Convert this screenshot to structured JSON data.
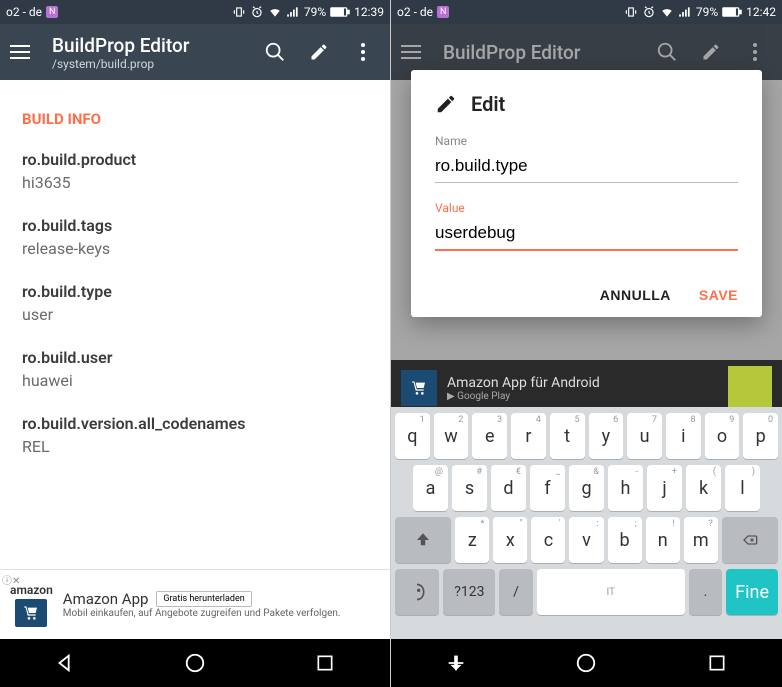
{
  "left": {
    "status": {
      "carrier": "o2 - de",
      "battery": "79%",
      "time": "12:39"
    },
    "toolbar": {
      "title": "BuildProp Editor",
      "subtitle": "/system/build.prop"
    },
    "section_header": "BUILD INFO",
    "props": [
      {
        "key": "ro.build.product",
        "val": "hi3635"
      },
      {
        "key": "ro.build.tags",
        "val": "release-keys"
      },
      {
        "key": "ro.build.type",
        "val": "user"
      },
      {
        "key": "ro.build.user",
        "val": "huawei"
      },
      {
        "key": "ro.build.version.all_codenames",
        "val": "REL"
      }
    ],
    "ad": {
      "brand": "amazon",
      "title": "Amazon App",
      "sub": "Mobil einkaufen, auf Angebote zugreifen und Pakete verfolgen.",
      "cta": "Gratis herunterladen"
    }
  },
  "right": {
    "status": {
      "carrier": "o2 - de",
      "battery": "79%",
      "time": "12:42"
    },
    "toolbar": {
      "title": "BuildProp Editor",
      "subtitle": "/system/build.prop"
    },
    "dialog": {
      "title": "Edit",
      "name_label": "Name",
      "name_value": "ro.build.type",
      "value_label": "Value",
      "value_value": "userdebug",
      "cancel": "ANNULLA",
      "save": "SAVE"
    },
    "adstrip": {
      "title": "Amazon App für Android",
      "sub": "Google Play"
    },
    "keyboard": {
      "row1": [
        "q",
        "w",
        "e",
        "r",
        "t",
        "y",
        "u",
        "i",
        "o",
        "p"
      ],
      "row1_hints": [
        "1",
        "2",
        "3",
        "4",
        "5",
        "6",
        "7",
        "8",
        "9",
        "0"
      ],
      "row2": [
        "a",
        "s",
        "d",
        "f",
        "g",
        "h",
        "j",
        "k",
        "l"
      ],
      "row2_hints": [
        "@",
        "#",
        "€",
        "_",
        "&",
        "-",
        "+",
        "(",
        ")"
      ],
      "row3": [
        "z",
        "x",
        "c",
        "v",
        "b",
        "n",
        "m"
      ],
      "row3_hints": [
        "*",
        "\"",
        "'",
        ":",
        ";",
        "!",
        "?"
      ],
      "symkey": "?123",
      "lang": "IT",
      "done": "Fine"
    }
  }
}
